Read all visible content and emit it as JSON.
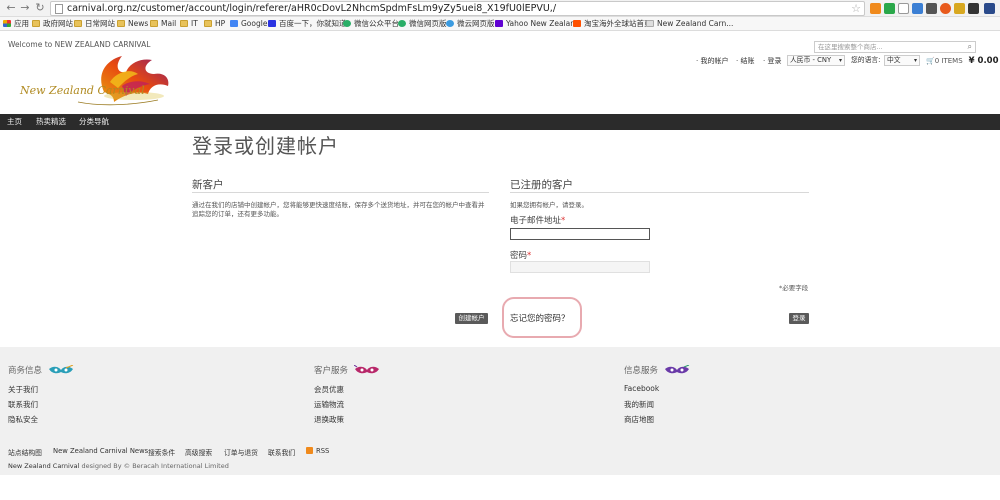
{
  "browser": {
    "url": "carnival.org.nz/customer/account/login/referer/aHR0cDovL2NhcmSpdmFsLm9yZy5uei8_X19fU0lEPVU,/",
    "back_icon": "back-arrow-icon",
    "forward_icon": "forward-arrow-icon",
    "reload_icon": "reload-icon",
    "bookmarks": [
      {
        "label": "应用",
        "icon": "apps-icon"
      },
      {
        "label": "政府网站",
        "icon": "folder-icon"
      },
      {
        "label": "日常网站",
        "icon": "folder-icon"
      },
      {
        "label": "News",
        "icon": "folder-icon"
      },
      {
        "label": "Mail",
        "icon": "folder-icon"
      },
      {
        "label": "IT",
        "icon": "folder-icon"
      },
      {
        "label": "HP",
        "icon": "folder-icon"
      },
      {
        "label": "Google",
        "icon": "google-icon"
      },
      {
        "label": "百度一下，你就知道",
        "icon": "baidu-icon"
      },
      {
        "label": "微信公众平台",
        "icon": "wechat-icon"
      },
      {
        "label": "微信网页版",
        "icon": "wechat-icon"
      },
      {
        "label": "微云网页版",
        "icon": "weiyun-icon"
      },
      {
        "label": "Yahoo New Zealand",
        "icon": "yahoo-icon"
      },
      {
        "label": "淘宝海外全球站首页",
        "icon": "taobao-icon"
      },
      {
        "label": "New Zealand Carn...",
        "icon": "page-icon"
      }
    ]
  },
  "header": {
    "welcome": "Welcome to NEW ZEALAND CARNIVAL",
    "logo_text": "New Zealand Carnival",
    "search_placeholder": "在这里搜索整个商店...",
    "links": {
      "account": "我的帐户",
      "checkout": "结账",
      "login": "登录"
    },
    "currency": "人民币 - CNY",
    "language_label": "您的语言:",
    "language": "中文",
    "cart_items": "0 ITEMS",
    "cart_total": "¥ 0.00"
  },
  "nav": [
    "主页",
    "热卖精选",
    "分类导航"
  ],
  "main": {
    "title": "登录或创建帐户",
    "new_customer": {
      "heading": "新客户",
      "text": "通过在我们的店铺中创建帐户，您将能够更快速度结账，保存多个送货地址，并可在您的帐户中查看并追踪您的订单，还有更多功能。",
      "button": "创建帐户"
    },
    "registered": {
      "heading": "已注册的客户",
      "text": "如果您拥有帐户，请登录。",
      "email_label": "电子邮件地址",
      "password_label": "密码",
      "required_mark": "*",
      "required_note": "*必要字段",
      "forgot": "忘记您的密码？",
      "button": "登录"
    }
  },
  "footer": {
    "columns": [
      {
        "heading": "商务信息",
        "links": [
          "关于我们",
          "联系我们",
          "隐私安全"
        ]
      },
      {
        "heading": "客户服务",
        "links": [
          "会员优惠",
          "运输物流",
          "退换政策"
        ]
      },
      {
        "heading": "信息服务",
        "links": [
          "Facebook",
          "我的新闻",
          "商店地图"
        ]
      }
    ],
    "bottom_links": [
      "站点结构图",
      "New Zealand Carnival News",
      "搜索条件",
      "高级搜索",
      "订单与退货",
      "联系我们",
      "RSS"
    ],
    "copyright_brand": "New Zealand Carnival",
    "copyright_rest": "designed By © Beracah International Limited"
  }
}
